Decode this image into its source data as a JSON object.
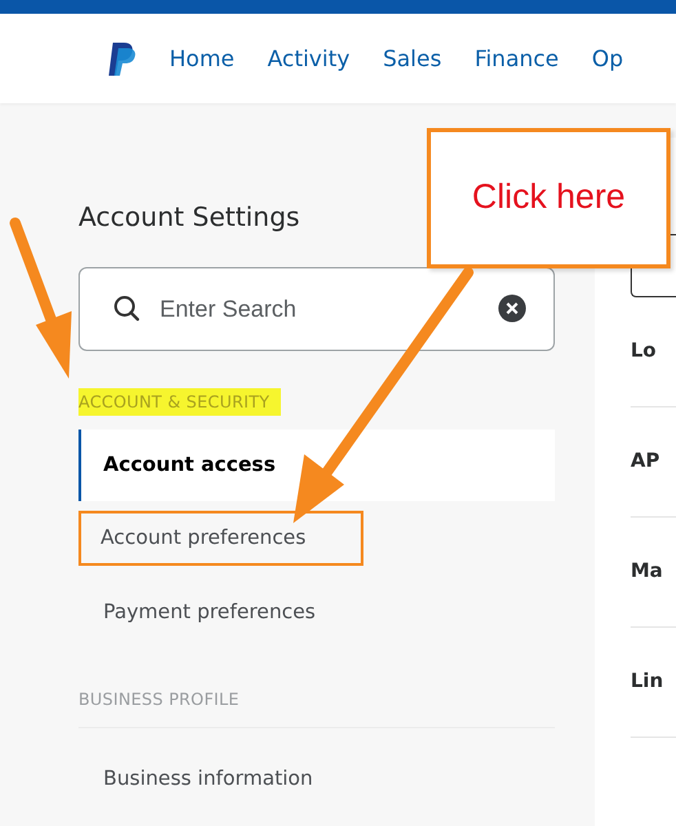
{
  "nav": {
    "items": [
      {
        "label": "Home"
      },
      {
        "label": "Activity"
      },
      {
        "label": "Sales"
      },
      {
        "label": "Finance"
      },
      {
        "label": "Op"
      }
    ]
  },
  "sidebar": {
    "title": "Account Settings",
    "search": {
      "placeholder": "Enter Search"
    },
    "sections": [
      {
        "heading": "ACCOUNT & SECURITY",
        "highlighted": true,
        "items": [
          {
            "label": "Account access",
            "selected": true,
            "outlined": false
          },
          {
            "label": "Account preferences",
            "selected": false,
            "outlined": true
          },
          {
            "label": "Payment preferences",
            "selected": false,
            "outlined": false
          }
        ]
      },
      {
        "heading": "BUSINESS PROFILE",
        "highlighted": false,
        "items": [
          {
            "label": "Business information",
            "selected": false,
            "outlined": false
          }
        ]
      }
    ]
  },
  "detail_panel": {
    "rows": [
      {
        "label": "Lo"
      },
      {
        "label": "AP"
      },
      {
        "label": "Ma"
      },
      {
        "label": "Lin"
      }
    ]
  },
  "annotation": {
    "callout": "Click here"
  }
}
